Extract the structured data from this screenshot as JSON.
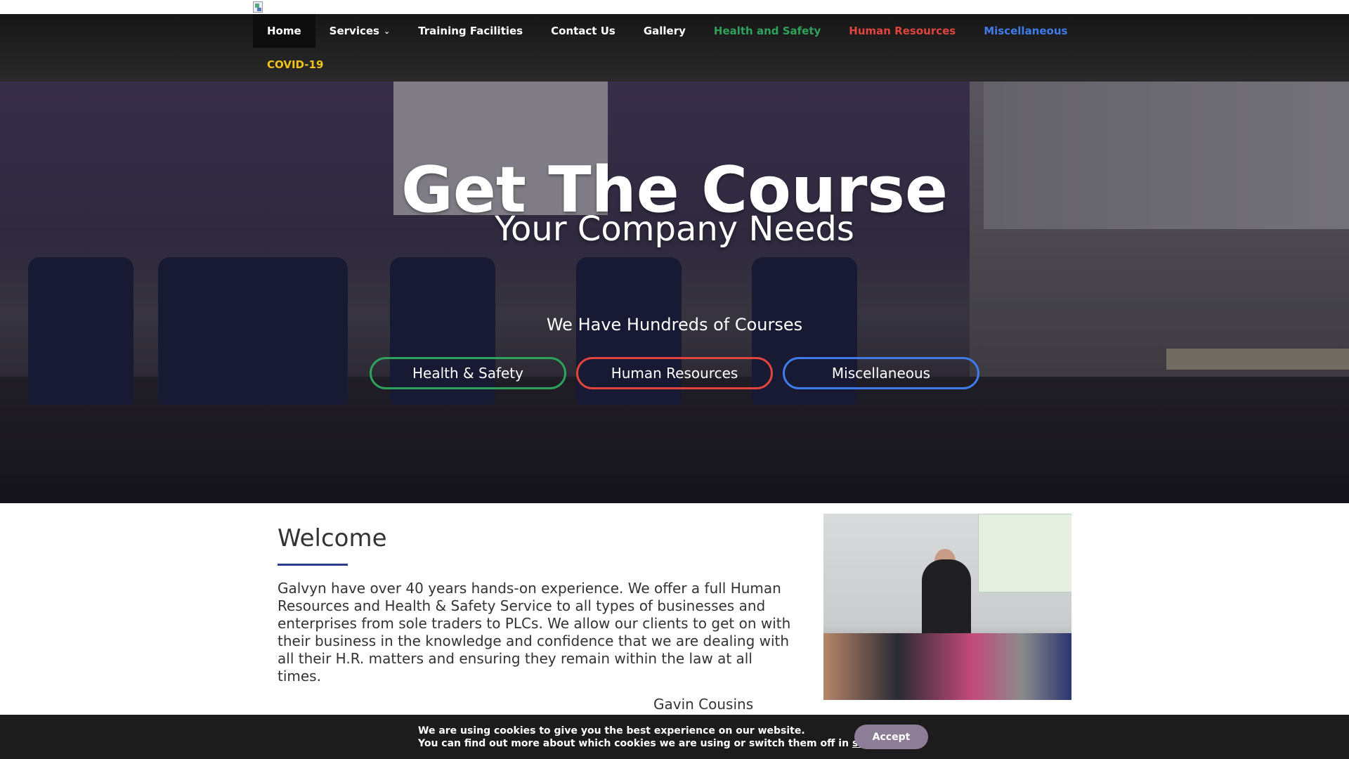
{
  "nav": {
    "row1": [
      {
        "label": "Home",
        "active": true
      },
      {
        "label": "Services",
        "dropdown": true
      },
      {
        "label": "Training Facilities"
      },
      {
        "label": "Contact Us"
      },
      {
        "label": "Gallery"
      },
      {
        "label": "Health and Safety",
        "color": "#2ea25a"
      },
      {
        "label": "Human Resources",
        "color": "#e0443c"
      },
      {
        "label": "Miscellaneous",
        "color": "#3f7bea"
      }
    ],
    "row2": [
      {
        "label": "COVID-19",
        "color": "#f2c21b"
      }
    ]
  },
  "hero": {
    "title": "Get The Course",
    "subtitle": "Your Company Needs",
    "lead": "We Have Hundreds of Courses",
    "buttons": [
      {
        "label": "Health & Safety",
        "color": "#2ea25a"
      },
      {
        "label": "Human Resources",
        "color": "#e0443c"
      },
      {
        "label": "Miscellaneous",
        "color": "#3f7bea"
      }
    ]
  },
  "welcome": {
    "title": "Welcome",
    "body": "Galvyn have over 40 years hands-on experience. We offer a full Human Resources and Health & Safety Service to all types of businesses and enterprises from sole traders to PLCs. We allow our clients to get on with their business in the knowledge and confidence that we are dealing with all their H.R. matters and ensuring they remain within the law at all times.",
    "signature": "Gavin Cousins",
    "accent_color": "#2e3b8f"
  },
  "cookie": {
    "line1": "We are using cookies to give you the best experience on our website.",
    "line2_prefix": "You can find out more about which cookies we are using or switch them off in ",
    "settings_link": "settings",
    "line2_suffix": ".",
    "accept_label": "Accept"
  }
}
